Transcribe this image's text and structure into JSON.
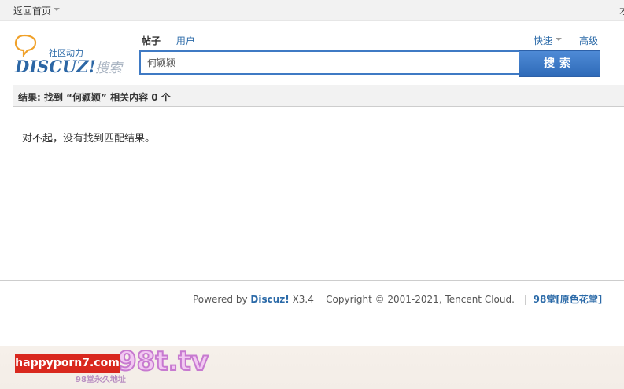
{
  "topbar": {
    "home_label": "返回首页",
    "right_edge_char": "才"
  },
  "logo": {
    "tagline": "社区动力",
    "wordmark": "DISCUZ!",
    "search_word": "搜索"
  },
  "search": {
    "tabs": [
      {
        "label": "帖子",
        "active": true
      },
      {
        "label": "用户",
        "active": false
      }
    ],
    "quick_label": "快速",
    "advanced_label": "高级",
    "input_value": "何颖颖",
    "button_label": "搜索"
  },
  "results": {
    "summary": "结果: 找到 “何颖颖” 相关内容 0 个",
    "empty_message": "对不起，没有找到匹配结果。"
  },
  "footer": {
    "powered_by": "Powered by",
    "product": "Discuz!",
    "version": "X3.4",
    "copyright": "Copyright © 2001-2021, Tencent Cloud.",
    "site_name": "98堂[原色花堂]"
  },
  "ad": {
    "label": "happyporn7.com",
    "domain": "98t.tv",
    "subtext": "98堂永久地址"
  }
}
